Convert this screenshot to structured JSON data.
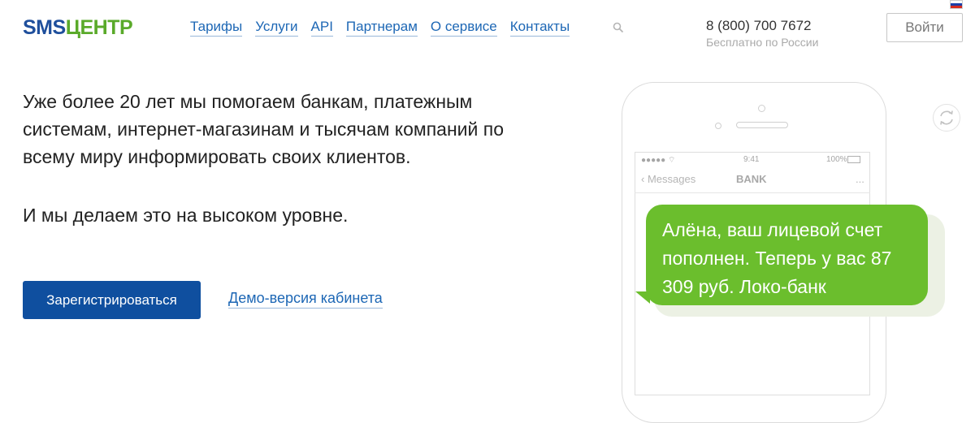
{
  "header": {
    "logo": {
      "part1": "SMS",
      "part2": "ЦЕНТР"
    },
    "nav": [
      {
        "label": "Тарифы"
      },
      {
        "label": "Услуги"
      },
      {
        "label": "API"
      },
      {
        "label": "Партнерам"
      },
      {
        "label": "О сервисе"
      },
      {
        "label": "Контакты"
      }
    ],
    "phone": "8 (800) 700 7672",
    "phone_note": "Бесплатно по России",
    "login_label": "Войти",
    "colors": {
      "brand_blue": "#1f4f9c",
      "brand_green": "#5aaa2a",
      "link": "#1d67b5"
    }
  },
  "hero": {
    "text1": "Уже более 20 лет мы помогаем банкам, платежным системам, интернет-магазинам и тысячам компаний по всему миру информировать своих клиентов.",
    "text2": "И мы делаем это на высоком уровне.",
    "register_label": "Зарегистрироваться",
    "demo_label": "Демо-версия кабинета"
  },
  "phone_mock": {
    "carrier": "●●●●● ⌔",
    "time": "9:41",
    "battery": "100%",
    "back_label": "‹ Messages",
    "title": "BANK",
    "dots": "...",
    "message": "Алёна, ваш лицевой счет пополнен. Теперь у вас 87 309 руб. Локо-банк",
    "bubble_color": "#6bbe2d"
  }
}
